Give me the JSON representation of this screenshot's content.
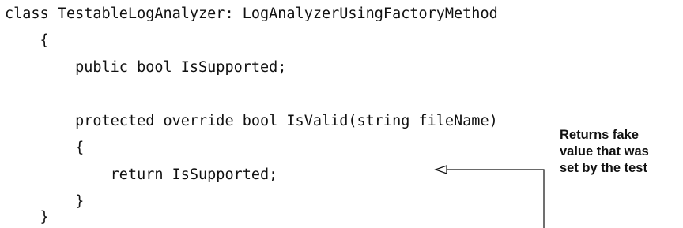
{
  "code": {
    "lines": [
      "class TestableLogAnalyzer: LogAnalyzerUsingFactoryMethod",
      "    {",
      "        public bool IsSupported;",
      "",
      "        protected override bool IsValid(string fileName)",
      "        {",
      "            return IsSupported;",
      "        }",
      "    }"
    ]
  },
  "annotation": {
    "lines": [
      "Returns fake",
      "value that was",
      "set by the test"
    ]
  }
}
